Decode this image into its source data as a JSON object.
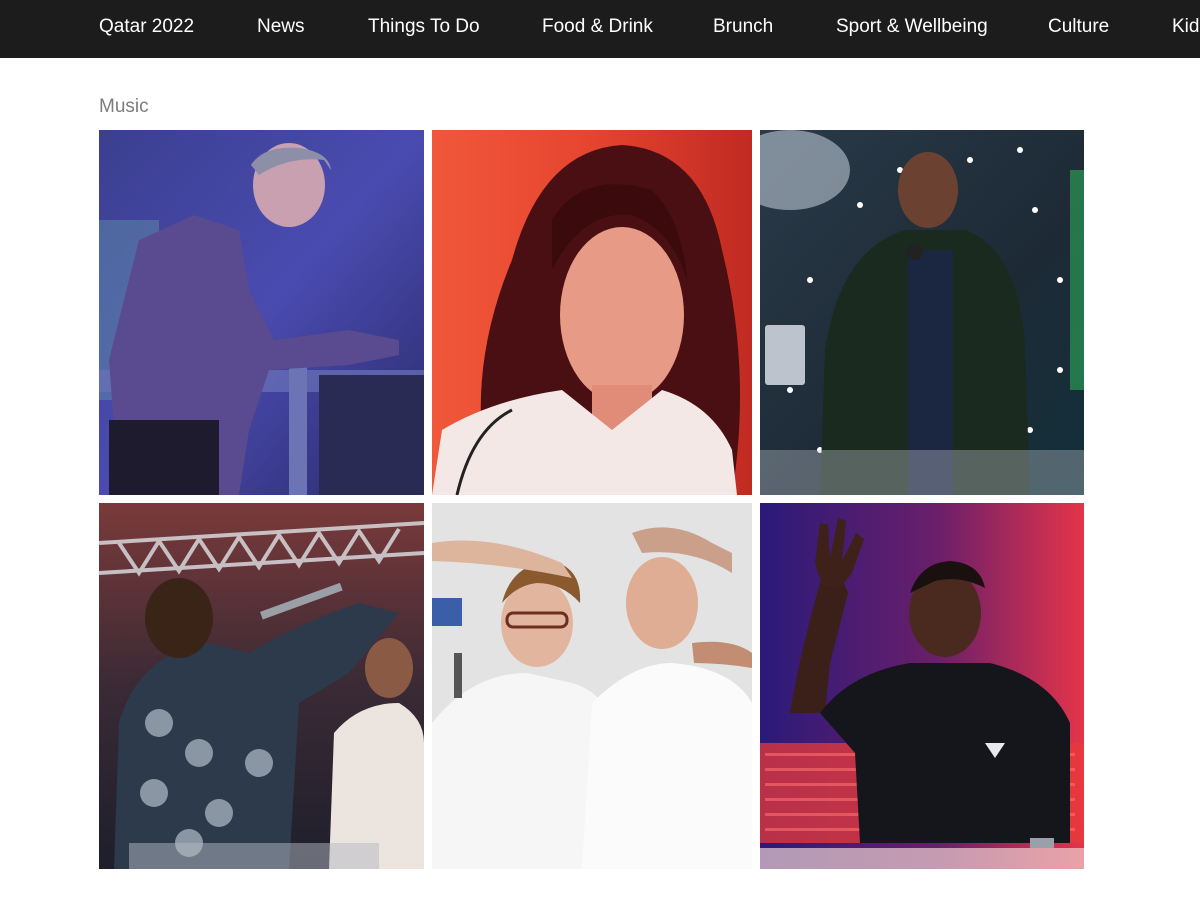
{
  "nav": {
    "items": [
      {
        "label": "Qatar 2022"
      },
      {
        "label": "News"
      },
      {
        "label": "Things To Do"
      },
      {
        "label": "Food & Drink"
      },
      {
        "label": "Brunch"
      },
      {
        "label": "Sport & Wellbeing"
      },
      {
        "label": "Culture"
      },
      {
        "label": "Kid"
      }
    ]
  },
  "section": {
    "label": "Music"
  },
  "gallery": {
    "tiles": [
      {
        "subject": "dj-at-turntables-photo"
      },
      {
        "subject": "woman-portrait-red-photo"
      },
      {
        "subject": "singer-with-microphone-photo"
      },
      {
        "subject": "rapper-performing-photo"
      },
      {
        "subject": "duo-in-white-shirts-photo"
      },
      {
        "subject": "dj-hand-raised-photo"
      }
    ]
  }
}
